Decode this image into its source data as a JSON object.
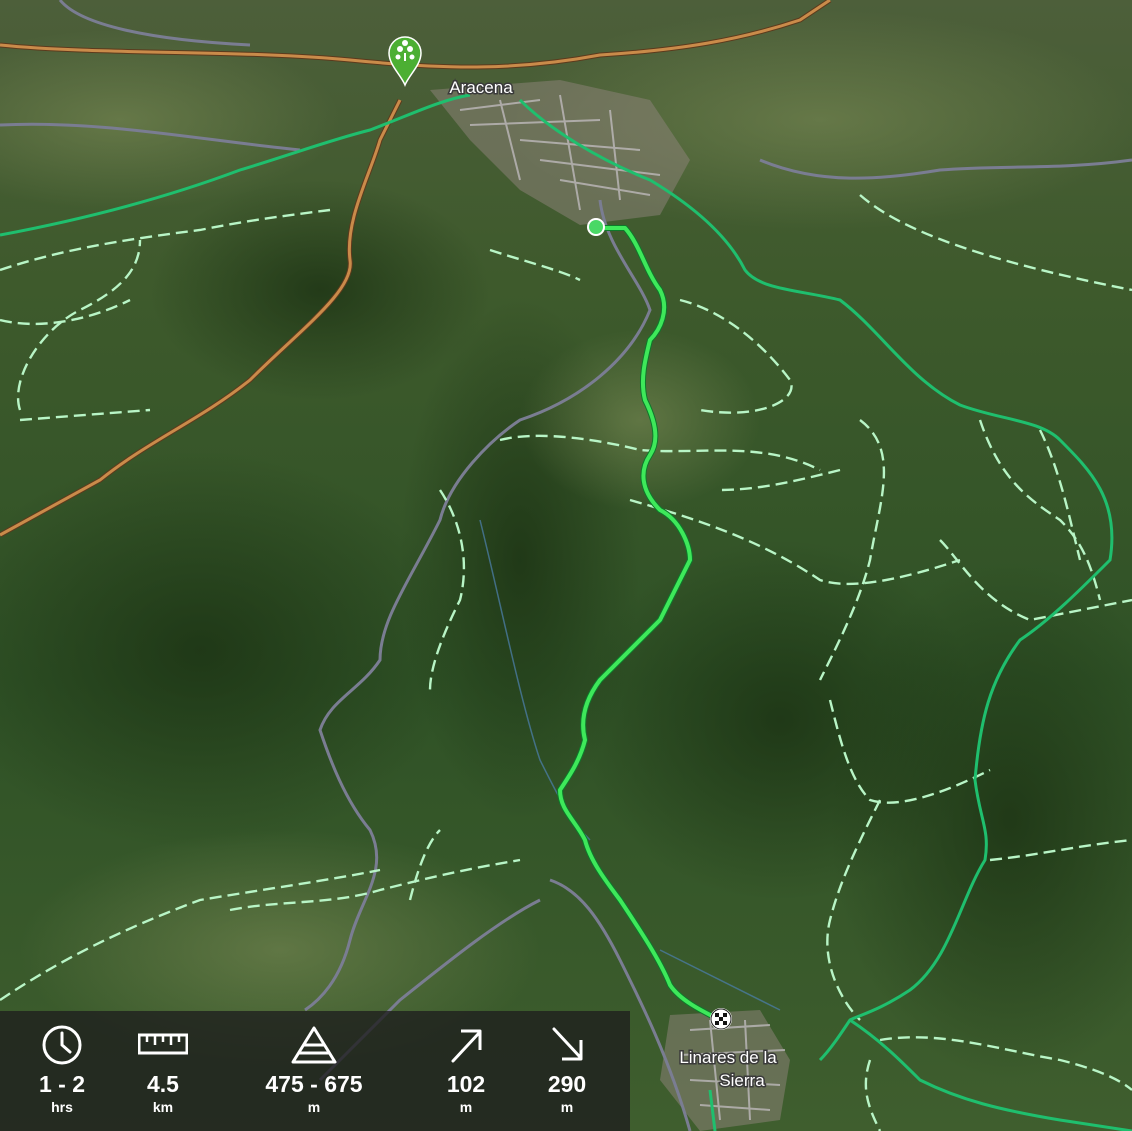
{
  "map": {
    "places": {
      "start": "Aracena",
      "end_line1": "Linares de la",
      "end_line2": "Sierra"
    },
    "icons": {
      "start_marker": "tree-pin-icon",
      "end_marker": "checkered-flag-icon",
      "route_dot": "route-start-dot"
    },
    "colors": {
      "route": "#3ee85a",
      "trail": "#1fbf6e",
      "path_dashed": "#b8f5c6",
      "main_road": "#c98b4a",
      "minor_road": "#7a7d92",
      "pin": "#4caf33"
    }
  },
  "stats": {
    "duration": {
      "icon": "clock-icon",
      "value": "1 - 2",
      "unit": "hrs"
    },
    "distance": {
      "icon": "ruler-icon",
      "value": "4.5",
      "unit": "km"
    },
    "elevation": {
      "icon": "mountain-icon",
      "value": "475 - 675",
      "unit": "m"
    },
    "ascent": {
      "icon": "arrow-up-right-icon",
      "value": "102",
      "unit": "m"
    },
    "descent": {
      "icon": "arrow-down-right-icon",
      "value": "290",
      "unit": "m"
    }
  }
}
